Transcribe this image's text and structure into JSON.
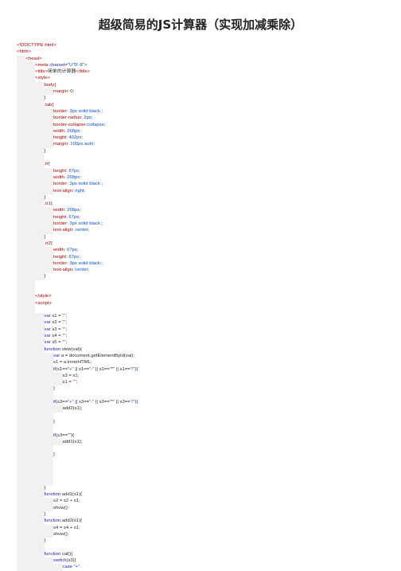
{
  "title": "超级简易的JS计算器（实现加减乘除）",
  "code_lines": [
    {
      "indent": 0,
      "parts": [
        {
          "c": "tag",
          "t": "<!DOCTYPE html>"
        }
      ]
    },
    {
      "indent": 0,
      "parts": [
        {
          "c": "tag",
          "t": "<html>"
        }
      ]
    },
    {
      "indent": 1,
      "parts": [
        {
          "c": "tag",
          "t": "<head>"
        }
      ]
    },
    {
      "indent": 2,
      "parts": [
        {
          "c": "tag",
          "t": "<meta "
        },
        {
          "c": "kw",
          "t": "charset"
        },
        {
          "c": "pn",
          "t": "="
        },
        {
          "c": "str",
          "t": "\"UTF-8\""
        },
        {
          "c": "tag",
          "t": ">"
        }
      ]
    },
    {
      "indent": 2,
      "parts": [
        {
          "c": "tag",
          "t": "<title>"
        },
        {
          "c": "pn",
          "t": "简单的计算器"
        },
        {
          "c": "tag",
          "t": "</title>"
        }
      ]
    },
    {
      "indent": 2,
      "parts": [
        {
          "c": "tag",
          "t": "<style>"
        }
      ]
    },
    {
      "indent": 3,
      "parts": [
        {
          "c": "tag",
          "t": "body"
        },
        {
          "c": "pn",
          "t": "{"
        }
      ]
    },
    {
      "indent": 4,
      "parts": [
        {
          "c": "tag",
          "t": "margin"
        },
        {
          "c": "pn",
          "t": ": 0;"
        }
      ]
    },
    {
      "indent": 3,
      "parts": [
        {
          "c": "pn",
          "t": "}"
        }
      ]
    },
    {
      "indent": 3,
      "parts": [
        {
          "c": "tag",
          "t": ".tab"
        },
        {
          "c": "pn",
          "t": "{"
        }
      ]
    },
    {
      "indent": 4,
      "parts": [
        {
          "c": "tag",
          "t": "border"
        },
        {
          "c": "pn",
          "t": ": "
        },
        {
          "c": "val",
          "t": "3px solid black"
        },
        {
          "c": "pn",
          "t": " ;"
        }
      ]
    },
    {
      "indent": 4,
      "parts": [
        {
          "c": "tag",
          "t": "border-radius"
        },
        {
          "c": "pn",
          "t": ": "
        },
        {
          "c": "val",
          "t": "2px"
        },
        {
          "c": "pn",
          "t": ";"
        }
      ]
    },
    {
      "indent": 4,
      "parts": [
        {
          "c": "tag",
          "t": "border-collapse"
        },
        {
          "c": "pn",
          "t": ":"
        },
        {
          "c": "val",
          "t": "collapse"
        },
        {
          "c": "pn",
          "t": ";"
        }
      ]
    },
    {
      "indent": 4,
      "parts": [
        {
          "c": "tag",
          "t": "width"
        },
        {
          "c": "pn",
          "t": ": "
        },
        {
          "c": "val",
          "t": "268px"
        },
        {
          "c": "pn",
          "t": ";"
        }
      ]
    },
    {
      "indent": 4,
      "parts": [
        {
          "c": "tag",
          "t": "height"
        },
        {
          "c": "pn",
          "t": ": "
        },
        {
          "c": "val",
          "t": "402px"
        },
        {
          "c": "pn",
          "t": ";"
        }
      ]
    },
    {
      "indent": 4,
      "parts": [
        {
          "c": "tag",
          "t": "margin"
        },
        {
          "c": "pn",
          "t": ": "
        },
        {
          "c": "val",
          "t": "100px auto"
        },
        {
          "c": "pn",
          "t": ";"
        }
      ]
    },
    {
      "indent": 3,
      "parts": [
        {
          "c": "pn",
          "t": "}"
        }
      ]
    },
    {
      "indent": 3,
      "parts": []
    },
    {
      "indent": 3,
      "parts": [
        {
          "c": "tag",
          "t": ".tr"
        },
        {
          "c": "pn",
          "t": "{"
        }
      ]
    },
    {
      "indent": 4,
      "parts": [
        {
          "c": "tag",
          "t": "height"
        },
        {
          "c": "pn",
          "t": ": "
        },
        {
          "c": "val",
          "t": "67px"
        },
        {
          "c": "pn",
          "t": ";"
        }
      ]
    },
    {
      "indent": 4,
      "parts": [
        {
          "c": "tag",
          "t": "width"
        },
        {
          "c": "pn",
          "t": ": "
        },
        {
          "c": "val",
          "t": "268px"
        },
        {
          "c": "pn",
          "t": ";"
        }
      ]
    },
    {
      "indent": 4,
      "parts": [
        {
          "c": "tag",
          "t": "border"
        },
        {
          "c": "pn",
          "t": ": "
        },
        {
          "c": "val",
          "t": "3px solid black"
        },
        {
          "c": "pn",
          "t": " ;"
        }
      ]
    },
    {
      "indent": 4,
      "parts": [
        {
          "c": "tag",
          "t": "text-align"
        },
        {
          "c": "pn",
          "t": ": "
        },
        {
          "c": "val",
          "t": "right"
        },
        {
          "c": "pn",
          "t": ";"
        }
      ]
    },
    {
      "indent": 3,
      "parts": [
        {
          "c": "pn",
          "t": "}"
        }
      ]
    },
    {
      "indent": 3,
      "parts": [
        {
          "c": "tag",
          "t": ".tr1"
        },
        {
          "c": "pn",
          "t": "{"
        }
      ]
    },
    {
      "indent": 4,
      "parts": [
        {
          "c": "tag",
          "t": "width"
        },
        {
          "c": "pn",
          "t": ": "
        },
        {
          "c": "val",
          "t": "268px"
        },
        {
          "c": "pn",
          "t": ";"
        }
      ]
    },
    {
      "indent": 4,
      "parts": [
        {
          "c": "tag",
          "t": "height"
        },
        {
          "c": "pn",
          "t": ": "
        },
        {
          "c": "val",
          "t": "67px"
        },
        {
          "c": "pn",
          "t": ";"
        }
      ]
    },
    {
      "indent": 4,
      "parts": [
        {
          "c": "tag",
          "t": "border"
        },
        {
          "c": "pn",
          "t": ": "
        },
        {
          "c": "val",
          "t": "3px solid black"
        },
        {
          "c": "pn",
          "t": " ;"
        }
      ]
    },
    {
      "indent": 4,
      "parts": [
        {
          "c": "tag",
          "t": "text-align"
        },
        {
          "c": "pn",
          "t": ": "
        },
        {
          "c": "val",
          "t": "center"
        },
        {
          "c": "pn",
          "t": ";"
        }
      ]
    },
    {
      "indent": 3,
      "parts": [
        {
          "c": "pn",
          "t": "}"
        }
      ]
    },
    {
      "indent": 3,
      "parts": [
        {
          "c": "tag",
          "t": ".tr2"
        },
        {
          "c": "pn",
          "t": "{"
        }
      ]
    },
    {
      "indent": 4,
      "parts": [
        {
          "c": "tag",
          "t": "width"
        },
        {
          "c": "pn",
          "t": ": "
        },
        {
          "c": "val",
          "t": "67px"
        },
        {
          "c": "pn",
          "t": ";"
        }
      ]
    },
    {
      "indent": 4,
      "parts": [
        {
          "c": "tag",
          "t": "height"
        },
        {
          "c": "pn",
          "t": ": "
        },
        {
          "c": "val",
          "t": "67px"
        },
        {
          "c": "pn",
          "t": ";"
        }
      ]
    },
    {
      "indent": 4,
      "parts": [
        {
          "c": "tag",
          "t": "border"
        },
        {
          "c": "pn",
          "t": ": "
        },
        {
          "c": "val",
          "t": "3px solid black"
        },
        {
          "c": "pn",
          "t": " ;"
        }
      ]
    },
    {
      "indent": 4,
      "parts": [
        {
          "c": "tag",
          "t": "text-align"
        },
        {
          "c": "pn",
          "t": ": "
        },
        {
          "c": "val",
          "t": "center"
        },
        {
          "c": "pn",
          "t": ";"
        }
      ]
    },
    {
      "indent": 3,
      "parts": [
        {
          "c": "pn",
          "t": "}"
        }
      ]
    },
    {
      "indent": 2,
      "parts": []
    },
    {
      "indent": 2,
      "parts": []
    },
    {
      "indent": 2,
      "parts": [
        {
          "c": "tag",
          "t": "</style>"
        }
      ]
    },
    {
      "indent": 2,
      "parts": [
        {
          "c": "tag",
          "t": "<script>"
        }
      ]
    },
    {
      "indent": 2,
      "parts": []
    },
    {
      "indent": 3,
      "parts": [
        {
          "c": "kw",
          "t": "var"
        },
        {
          "c": "pn",
          "t": " s1 = "
        },
        {
          "c": "str",
          "t": "\"\""
        },
        {
          "c": "pn",
          "t": ";"
        }
      ]
    },
    {
      "indent": 3,
      "parts": [
        {
          "c": "kw",
          "t": "var"
        },
        {
          "c": "pn",
          "t": " s2 = "
        },
        {
          "c": "str",
          "t": "\"\""
        },
        {
          "c": "pn",
          "t": ";"
        }
      ]
    },
    {
      "indent": 3,
      "parts": [
        {
          "c": "kw",
          "t": "var"
        },
        {
          "c": "pn",
          "t": " s3 = "
        },
        {
          "c": "str",
          "t": "\"\""
        },
        {
          "c": "pn",
          "t": ";"
        }
      ]
    },
    {
      "indent": 3,
      "parts": [
        {
          "c": "kw",
          "t": "var"
        },
        {
          "c": "pn",
          "t": " s4 = "
        },
        {
          "c": "str",
          "t": "\"\""
        },
        {
          "c": "pn",
          "t": ";"
        }
      ]
    },
    {
      "indent": 3,
      "parts": [
        {
          "c": "kw",
          "t": "var"
        },
        {
          "c": "pn",
          "t": " s5 = "
        },
        {
          "c": "str",
          "t": "\"\""
        },
        {
          "c": "pn",
          "t": ";"
        }
      ]
    },
    {
      "indent": 3,
      "parts": [
        {
          "c": "kw",
          "t": "function"
        },
        {
          "c": "pn",
          "t": " view(val){"
        }
      ]
    },
    {
      "indent": 4,
      "parts": [
        {
          "c": "kw",
          "t": "var"
        },
        {
          "c": "pn",
          "t": " a = document.getElementById(val);"
        }
      ]
    },
    {
      "indent": 4,
      "parts": [
        {
          "c": "pn",
          "t": "s1 = a.innerHTML;"
        }
      ]
    },
    {
      "indent": 4,
      "parts": [
        {
          "c": "kw",
          "t": "if"
        },
        {
          "c": "pn",
          "t": "(s1=="
        },
        {
          "c": "str",
          "t": "\"+\""
        },
        {
          "c": "pn",
          "t": " || s1=="
        },
        {
          "c": "str",
          "t": "\"-\""
        },
        {
          "c": "pn",
          "t": " || s1=="
        },
        {
          "c": "str",
          "t": "\"*\""
        },
        {
          "c": "pn",
          "t": " || s1=="
        },
        {
          "c": "str",
          "t": "\"/\""
        },
        {
          "c": "pn",
          "t": "){"
        }
      ]
    },
    {
      "indent": 5,
      "parts": [
        {
          "c": "pn",
          "t": "s3 = s1;"
        }
      ]
    },
    {
      "indent": 5,
      "parts": [
        {
          "c": "pn",
          "t": "s1 = "
        },
        {
          "c": "str",
          "t": "\"\""
        },
        {
          "c": "pn",
          "t": ";"
        }
      ]
    },
    {
      "indent": 4,
      "parts": [
        {
          "c": "pn",
          "t": "}"
        }
      ]
    },
    {
      "indent": 4,
      "parts": []
    },
    {
      "indent": 4,
      "parts": [
        {
          "c": "kw",
          "t": "if"
        },
        {
          "c": "pn",
          "t": "(s3=="
        },
        {
          "c": "str",
          "t": "\"+\""
        },
        {
          "c": "pn",
          "t": " || s3=="
        },
        {
          "c": "str",
          "t": "\"-\""
        },
        {
          "c": "pn",
          "t": " || s3=="
        },
        {
          "c": "str",
          "t": "\"*\""
        },
        {
          "c": "pn",
          "t": " || s3=="
        },
        {
          "c": "str",
          "t": "\"/\""
        },
        {
          "c": "pn",
          "t": "){"
        }
      ]
    },
    {
      "indent": 5,
      "parts": [
        {
          "c": "pn",
          "t": "add2(s1);"
        }
      ]
    },
    {
      "indent": 4,
      "parts": []
    },
    {
      "indent": 4,
      "parts": [
        {
          "c": "pn",
          "t": "}"
        }
      ]
    },
    {
      "indent": 4,
      "parts": []
    },
    {
      "indent": 4,
      "parts": [
        {
          "c": "kw",
          "t": "if"
        },
        {
          "c": "pn",
          "t": "(s3=="
        },
        {
          "c": "str",
          "t": "\"\""
        },
        {
          "c": "pn",
          "t": "){"
        }
      ]
    },
    {
      "indent": 5,
      "parts": [
        {
          "c": "pn",
          "t": "add1(s1);"
        }
      ]
    },
    {
      "indent": 4,
      "parts": []
    },
    {
      "indent": 4,
      "parts": [
        {
          "c": "pn",
          "t": "}"
        }
      ]
    },
    {
      "indent": 4,
      "parts": []
    },
    {
      "indent": 4,
      "parts": []
    },
    {
      "indent": 4,
      "parts": []
    },
    {
      "indent": 4,
      "parts": []
    },
    {
      "indent": 3,
      "parts": [
        {
          "c": "pn",
          "t": "}"
        }
      ]
    },
    {
      "indent": 3,
      "parts": [
        {
          "c": "kw",
          "t": "function"
        },
        {
          "c": "pn",
          "t": " add1(s1){"
        }
      ]
    },
    {
      "indent": 4,
      "parts": [
        {
          "c": "pn",
          "t": "s2 = s2 + s1;"
        }
      ]
    },
    {
      "indent": 4,
      "parts": [
        {
          "c": "pn",
          "t": "show();"
        }
      ]
    },
    {
      "indent": 3,
      "parts": [
        {
          "c": "pn",
          "t": "}"
        }
      ]
    },
    {
      "indent": 3,
      "parts": [
        {
          "c": "kw",
          "t": "function"
        },
        {
          "c": "pn",
          "t": " add2(s1){"
        }
      ]
    },
    {
      "indent": 4,
      "parts": [
        {
          "c": "pn",
          "t": "s4 = s4 + s1;"
        }
      ]
    },
    {
      "indent": 4,
      "parts": [
        {
          "c": "pn",
          "t": "show();"
        }
      ]
    },
    {
      "indent": 3,
      "parts": [
        {
          "c": "pn",
          "t": "}"
        }
      ]
    },
    {
      "indent": 3,
      "parts": []
    },
    {
      "indent": 3,
      "parts": [
        {
          "c": "kw",
          "t": "function"
        },
        {
          "c": "pn",
          "t": " cal(){"
        }
      ]
    },
    {
      "indent": 4,
      "parts": [
        {
          "c": "kw",
          "t": "switch"
        },
        {
          "c": "pn",
          "t": "(s3){"
        }
      ]
    },
    {
      "indent": 5,
      "parts": [
        {
          "c": "kw",
          "t": "case"
        },
        {
          "c": "pn",
          "t": " "
        },
        {
          "c": "str",
          "t": "\"+\""
        },
        {
          "c": "pn",
          "t": ":"
        }
      ]
    }
  ]
}
